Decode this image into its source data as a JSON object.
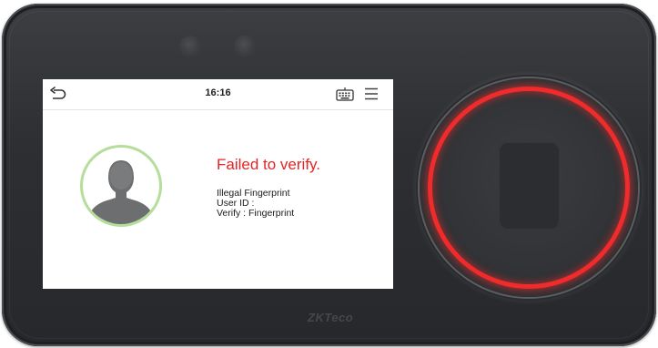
{
  "status_bar": {
    "time": "16:16",
    "back_icon": "back-arrow-icon",
    "keyboard_icon": "keyboard-icon",
    "menu_icon": "menu-icon"
  },
  "verification": {
    "title": "Failed to verify.",
    "lines": [
      "Illegal Fingerprint",
      "User ID :",
      "Verify : Fingerprint"
    ]
  },
  "avatar": {
    "icon": "user-silhouette-icon"
  },
  "device": {
    "brand": "ZKTeco"
  },
  "colors": {
    "error_red": "#e32525",
    "avatar_ring": "#b5dd9b",
    "sensor_ring": "#ef2b2b",
    "device_body": "#2d2f33"
  }
}
